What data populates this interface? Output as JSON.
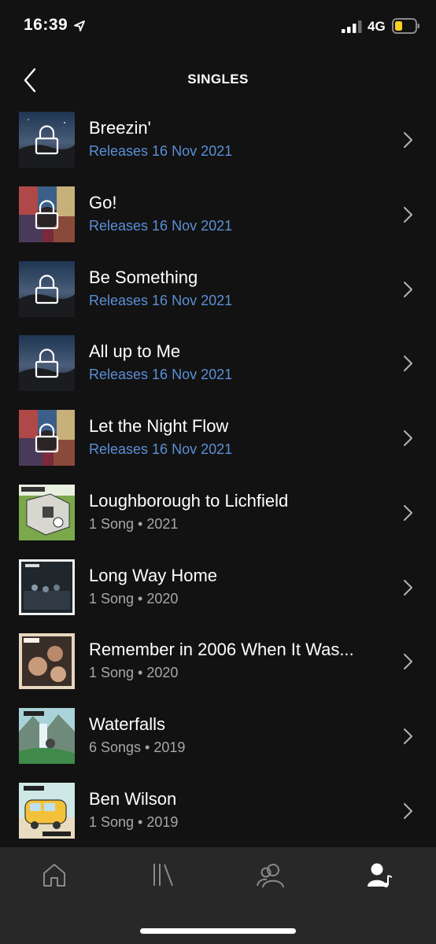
{
  "status_bar": {
    "time": "16:39",
    "network": "4G",
    "icons": [
      "location-arrow-icon",
      "signal-bars-icon",
      "battery-icon"
    ],
    "battery_color": "#f5d020"
  },
  "header": {
    "title": "SINGLES",
    "back_icon": "chevron-left-icon"
  },
  "colors": {
    "background": "#121212",
    "nav_background": "#282828",
    "release_text": "#5b8fd6",
    "secondary_text": "#a7a7a7"
  },
  "singles": [
    {
      "title": "Breezin'",
      "subtitle": "Releases 16 Nov 2021",
      "locked": true,
      "cover": "night-landscape"
    },
    {
      "title": "Go!",
      "subtitle": "Releases 16 Nov 2021",
      "locked": true,
      "cover": "collage"
    },
    {
      "title": "Be Something",
      "subtitle": "Releases 16 Nov 2021",
      "locked": true,
      "cover": "night-landscape"
    },
    {
      "title": "All up to Me",
      "subtitle": "Releases 16 Nov 2021",
      "locked": true,
      "cover": "night-landscape"
    },
    {
      "title": "Let the Night Flow",
      "subtitle": "Releases 16 Nov 2021",
      "locked": true,
      "cover": "collage"
    },
    {
      "title": "Loughborough to Lichfield",
      "subtitle": "1 Song • 2021",
      "locked": false,
      "cover": "green-room"
    },
    {
      "title": "Long Way Home",
      "subtitle": "1 Song • 2020",
      "locked": false,
      "cover": "dark-photo"
    },
    {
      "title": "Remember in 2006 When It Was...",
      "subtitle": "1 Song • 2020",
      "locked": false,
      "cover": "friends-photo"
    },
    {
      "title": "Waterfalls",
      "subtitle": "6 Songs • 2019",
      "locked": false,
      "cover": "waterfall-illustration"
    },
    {
      "title": "Ben Wilson",
      "subtitle": "1 Song • 2019",
      "locked": false,
      "cover": "van-illustration"
    }
  ],
  "bottom_nav": [
    {
      "name": "home",
      "icon": "home-icon",
      "active": false
    },
    {
      "name": "library",
      "icon": "library-icon",
      "active": false
    },
    {
      "name": "friends",
      "icon": "friends-icon",
      "active": false
    },
    {
      "name": "artist",
      "icon": "artist-profile-icon",
      "active": true
    }
  ]
}
